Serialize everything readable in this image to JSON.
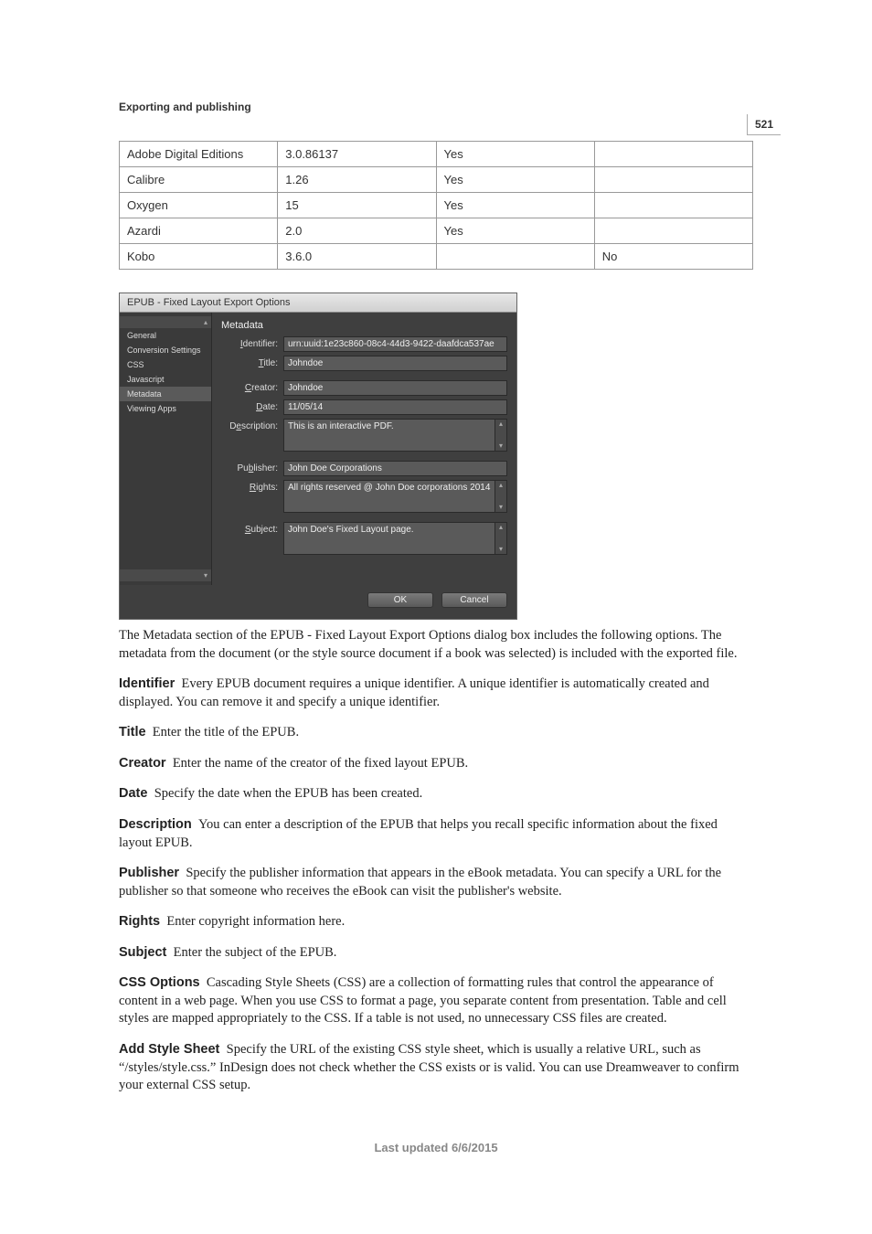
{
  "page_number": "521",
  "section_title": "Exporting and publishing",
  "table": {
    "rows": [
      {
        "c1": "Adobe Digital Editions",
        "c2": "3.0.86137",
        "c3": "Yes",
        "c4": ""
      },
      {
        "c1": "Calibre",
        "c2": "1.26",
        "c3": "Yes",
        "c4": ""
      },
      {
        "c1": "Oxygen",
        "c2": "15",
        "c3": "Yes",
        "c4": ""
      },
      {
        "c1": "Azardi",
        "c2": "2.0",
        "c3": "Yes",
        "c4": ""
      },
      {
        "c1": "Kobo",
        "c2": "3.6.0",
        "c3": "",
        "c4": "No"
      }
    ]
  },
  "dialog": {
    "title": "EPUB - Fixed Layout Export Options",
    "sidebar": {
      "items": [
        {
          "label": "General"
        },
        {
          "label": "Conversion Settings"
        },
        {
          "label": "CSS"
        },
        {
          "label": "Javascript"
        },
        {
          "label": "Metadata"
        },
        {
          "label": "Viewing Apps"
        }
      ]
    },
    "section_header": "Metadata",
    "fields": {
      "identifier": {
        "label": "Identifier:",
        "u": "I",
        "value": "urn:uuid:1e23c860-08c4-44d3-9422-daafdca537ae"
      },
      "title": {
        "label": "Title:",
        "u": "T",
        "value": "Johndoe"
      },
      "creator": {
        "label": "Creator:",
        "u": "C",
        "value": "Johndoe"
      },
      "date": {
        "label": "Date:",
        "u": "D",
        "value": "11/05/14"
      },
      "description": {
        "label": "Description:",
        "u": "D",
        "value": "This is an interactive PDF."
      },
      "publisher": {
        "label": "Publisher:",
        "u": "P",
        "value": "John Doe Corporations"
      },
      "rights": {
        "label": "Rights:",
        "u": "R",
        "value": "All rights reserved @ John Doe corporations 2014"
      },
      "subject": {
        "label": "Subject:",
        "u": "S",
        "value": "John Doe's Fixed Layout page."
      }
    },
    "buttons": {
      "ok": "OK",
      "cancel": "Cancel"
    }
  },
  "body": {
    "intro": "The Metadata section of the EPUB - Fixed Layout Export Options dialog box includes the following options. The metadata from the document (or the style source document if a book was selected) is included with the exported file.",
    "identifier_term": "Identifier",
    "identifier_text": "Every EPUB document requires a unique identifier. A unique identifier is automatically created and displayed. You can remove it and specify a unique identifier.",
    "title_term": "Title",
    "title_text": "Enter the title of the EPUB.",
    "creator_term": "Creator",
    "creator_text": "Enter the name of the creator of the fixed layout EPUB.",
    "date_term": "Date",
    "date_text": "Specify the date when the EPUB has been created.",
    "description_term": "Description",
    "description_text": "You can enter a description of the EPUB that helps you recall specific information about the fixed layout EPUB.",
    "publisher_term": "Publisher",
    "publisher_text": "Specify the publisher information that appears in the eBook metadata. You can specify a URL for the publisher so that someone who receives the eBook can visit the publisher's website.",
    "rights_term": "Rights",
    "rights_text": "Enter copyright information here.",
    "subject_term": "Subject",
    "subject_text": "Enter the subject of the EPUB.",
    "css_term": "CSS Options",
    "css_text": "Cascading Style Sheets (CSS) are a collection of formatting rules that control the appearance of content in a web page. When you use CSS to format a page, you separate content from presentation. Table and cell styles are mapped appropriately to the CSS. If a table is not used, no unnecessary CSS files are created.",
    "addss_term": "Add Style Sheet",
    "addss_text": "Specify the URL of the existing CSS style sheet, which is usually a relative URL, such as “/styles/style.css.” InDesign does not check whether the CSS exists or is valid. You can use Dreamweaver to confirm your external CSS setup."
  },
  "footer": "Last updated 6/6/2015"
}
